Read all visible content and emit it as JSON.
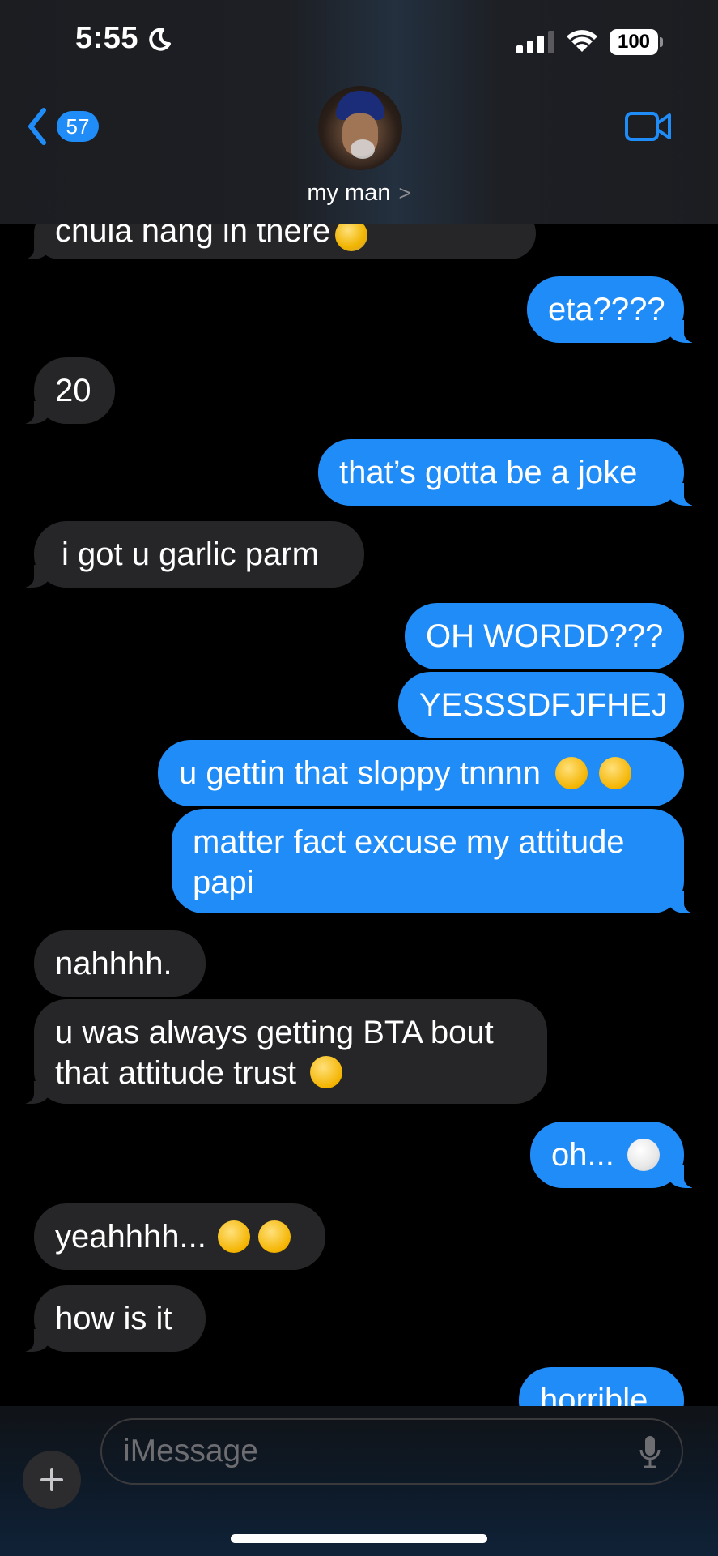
{
  "status_bar": {
    "time": "5:55",
    "battery": "100"
  },
  "header": {
    "back_count": "57",
    "contact_name": "my man",
    "contact_chevron": ">"
  },
  "messages": [
    {
      "direction": "in",
      "text": "chula hang in there",
      "emoji": "😰"
    },
    {
      "direction": "out",
      "text": "eta????"
    },
    {
      "direction": "in",
      "text": "20"
    },
    {
      "direction": "out",
      "text": "that’s gotta be a joke"
    },
    {
      "direction": "in",
      "text": "i got u garlic parm"
    },
    {
      "direction": "out",
      "text": "OH WORDD???"
    },
    {
      "direction": "out",
      "text": "YESSSDFJFHEJ"
    },
    {
      "direction": "out",
      "text": "u gettin that sloppy tnnnn",
      "emoji": "😩 😩"
    },
    {
      "direction": "out",
      "text": "matter fact excuse my attitude papi"
    },
    {
      "direction": "in",
      "text": "nahhhh."
    },
    {
      "direction": "in",
      "text": "u was always getting BTA bout that attitude trust",
      "emoji": "😔"
    },
    {
      "direction": "out",
      "text": "oh...",
      "emoji": "😶‍🌫️"
    },
    {
      "direction": "in",
      "text": "yeahhhh...",
      "emoji": "🤣 🤣"
    },
    {
      "direction": "in",
      "text": "how is it"
    },
    {
      "direction": "out",
      "text": "horrible"
    }
  ],
  "composer": {
    "placeholder": "iMessage",
    "plus_icon": "plus-icon",
    "mic_icon": "mic-icon"
  },
  "colors": {
    "outgoing_bubble": "#1f8cf8",
    "incoming_bubble": "#262628",
    "background": "#000000"
  }
}
